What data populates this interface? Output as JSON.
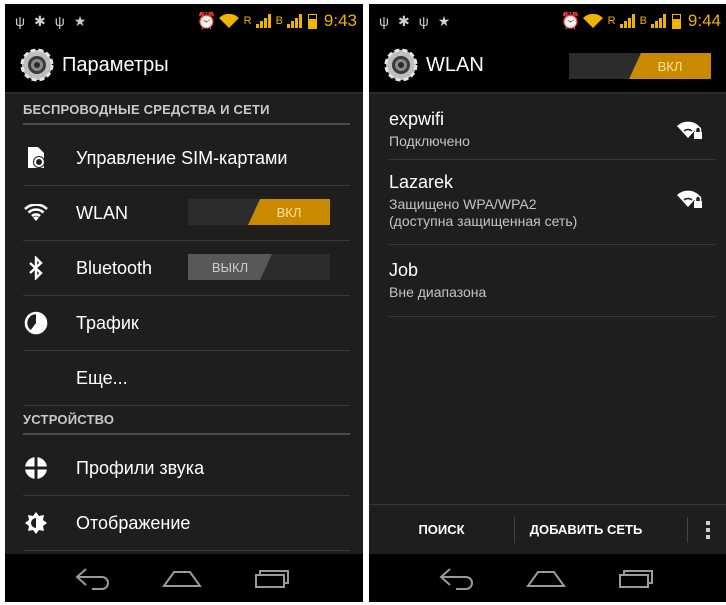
{
  "left": {
    "status_bar": {
      "time": "9:43"
    },
    "action_bar": {
      "title": "Параметры",
      "icon": "settings-gear-icon"
    },
    "sections": [
      {
        "header": "БЕСПРОВОДНЫЕ СРЕДСТВА И СЕТИ"
      },
      {
        "header": "УСТРОЙСТВО"
      }
    ],
    "items": [
      {
        "label": "Управление SIM-картами",
        "icon": "sim-card-icon"
      },
      {
        "label": "WLAN",
        "icon": "wifi-icon",
        "toggle": "ВКЛ",
        "toggle_state": "on"
      },
      {
        "label": "Bluetooth",
        "icon": "bluetooth-icon",
        "toggle": "ВЫКЛ",
        "toggle_state": "off"
      },
      {
        "label": "Трафик",
        "icon": "data-usage-icon"
      },
      {
        "label": "Еще..."
      },
      {
        "label": "Профили звука",
        "icon": "sound-profile-icon"
      },
      {
        "label": "Отображение",
        "icon": "display-brightness-icon"
      }
    ]
  },
  "right": {
    "status_bar": {
      "time": "9:44"
    },
    "action_bar": {
      "title": "WLAN",
      "icon": "settings-gear-icon",
      "toggle": "ВКЛ",
      "toggle_state": "on"
    },
    "networks": [
      {
        "ssid": "expwifi",
        "status": "Подключено",
        "secured": true
      },
      {
        "ssid": "Lazarek",
        "status": "Защищено WPA/WPA2",
        "status2": "(доступна защищенная сеть)",
        "secured": true
      },
      {
        "ssid": "Job",
        "status": "Вне диапазона"
      }
    ],
    "bottom_actions": {
      "search": "ПОИСК",
      "add_network": "ДОБАВИТЬ СЕТЬ"
    }
  },
  "colors": {
    "accent": "#c98a00",
    "status_icons": "#f0b400",
    "background": "#201e1c",
    "bar": "#000000"
  }
}
